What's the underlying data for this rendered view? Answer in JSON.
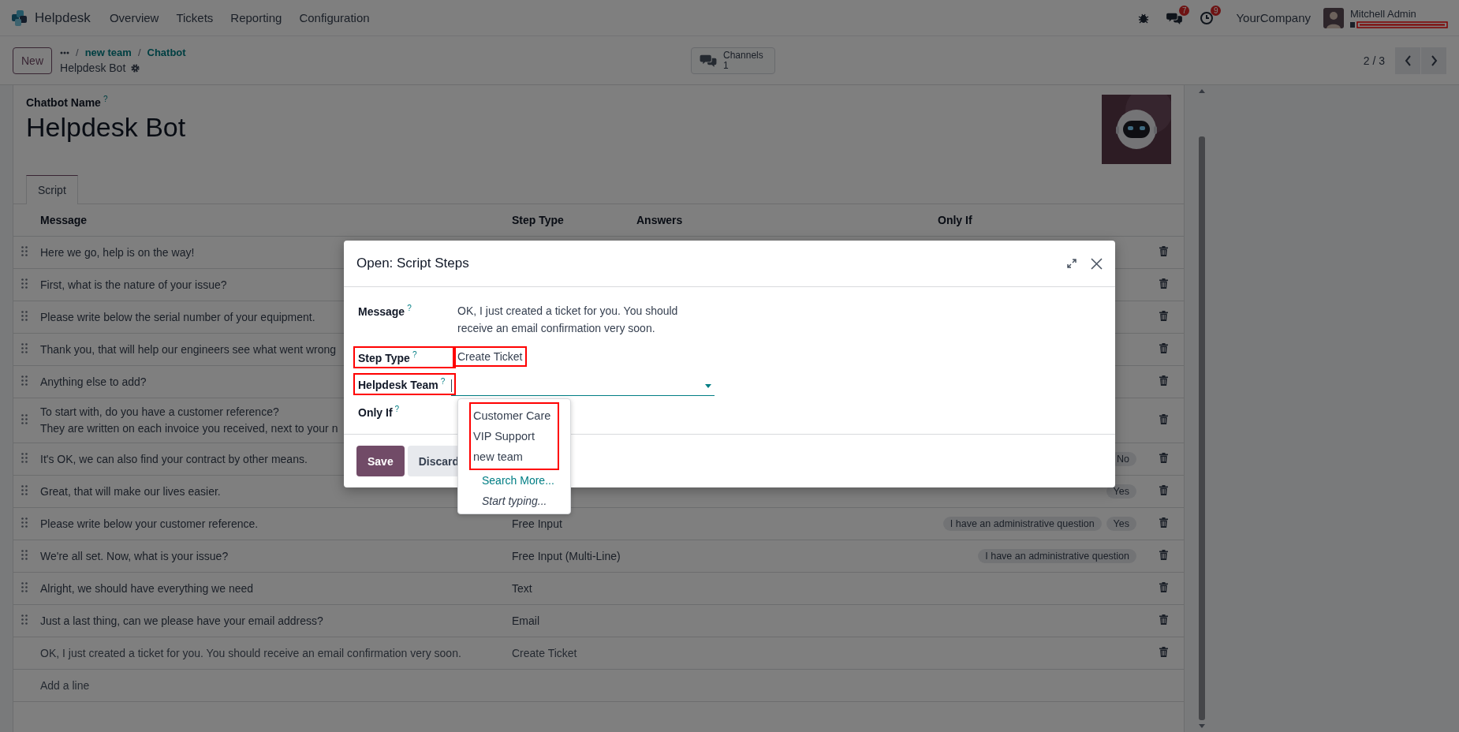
{
  "navbar": {
    "app": "Helpdesk",
    "menus": [
      "Overview",
      "Tickets",
      "Reporting",
      "Configuration"
    ],
    "messages_badge": "7",
    "activities_badge": "9",
    "company": "YourCompany",
    "user": "Mitchell Admin"
  },
  "control_panel": {
    "new_button": "New",
    "breadcrumbs": [
      {
        "separator": "/",
        "label": "new team"
      },
      {
        "separator": "/",
        "label": "Chatbot"
      }
    ],
    "record": "Helpdesk Bot",
    "channels": {
      "label": "Channels",
      "count": "1"
    },
    "pager": "2 / 3"
  },
  "form": {
    "name_label": "Chatbot Name",
    "name_help": "?",
    "name": "Helpdesk Bot",
    "tabs": [
      {
        "label": "Script",
        "selected": true
      }
    ]
  },
  "table": {
    "columns": [
      "Message",
      "Step Type",
      "Answers",
      "Only If"
    ],
    "rows": [
      {
        "message": "Here we go, help is on the way!",
        "draggable": true
      },
      {
        "message": "First, what is the nature of your issue?",
        "draggable": true
      },
      {
        "message": "Please write below the serial number of your equipment.",
        "draggable": true
      },
      {
        "message": "Thank you, that will help our engineers see what went wrong",
        "draggable": true
      },
      {
        "message": "Anything else to add?",
        "draggable": true
      },
      {
        "message": "To start with, do you have a customer reference?\nThey are written on each invoice you received, next to your n",
        "draggable": true
      },
      {
        "message": "It's OK, we can also find your contract by other means.",
        "draggable": true,
        "only_if": [
          "No"
        ]
      },
      {
        "message": "Great, that will make our lives easier.",
        "draggable": true,
        "only_if": [
          "Yes"
        ]
      },
      {
        "message": "Please write below your customer reference.",
        "step_type": "Free Input",
        "draggable": true,
        "only_if": [
          "I have an administrative question",
          "Yes"
        ]
      },
      {
        "message": "We're all set. Now, what is your issue?",
        "step_type": "Free Input (Multi-Line)",
        "draggable": true,
        "only_if": [
          "I have an administrative question"
        ]
      },
      {
        "message": "Alright, we should have everything we need",
        "step_type": "Text",
        "draggable": true
      },
      {
        "message": "Just a last thing, can we please have your email address?",
        "step_type": "Email",
        "draggable": true
      },
      {
        "message": "OK, I just created a ticket for you. You should receive an email confirmation very soon.",
        "step_type": "Create Ticket",
        "draggable": false
      }
    ],
    "add_line": "Add a line"
  },
  "modal": {
    "title": "Open: Script Steps",
    "fields": [
      {
        "kind": "text",
        "label": "Message",
        "help": "?",
        "value": "OK, I just created a ticket for you. You should receive an email confirmation very soon.",
        "annotated": false,
        "value_annotated": false
      },
      {
        "kind": "text",
        "label": "Step Type",
        "help": "?",
        "value": "Create Ticket",
        "annotated": true,
        "value_annotated": true
      },
      {
        "kind": "select",
        "label": "Helpdesk Team",
        "help": "?",
        "annotated": true
      },
      {
        "kind": "empty",
        "label": "Only If",
        "help": "?",
        "annotated": false
      }
    ],
    "dropdown": {
      "options": [
        "Customer Care",
        "VIP Support",
        "new team"
      ],
      "annotated": true,
      "search_more": "Search More...",
      "hint": "Start typing..."
    },
    "buttons": [
      {
        "label": "Save",
        "kind": "primary"
      },
      {
        "label": "Discard",
        "kind": "secondary"
      }
    ]
  }
}
